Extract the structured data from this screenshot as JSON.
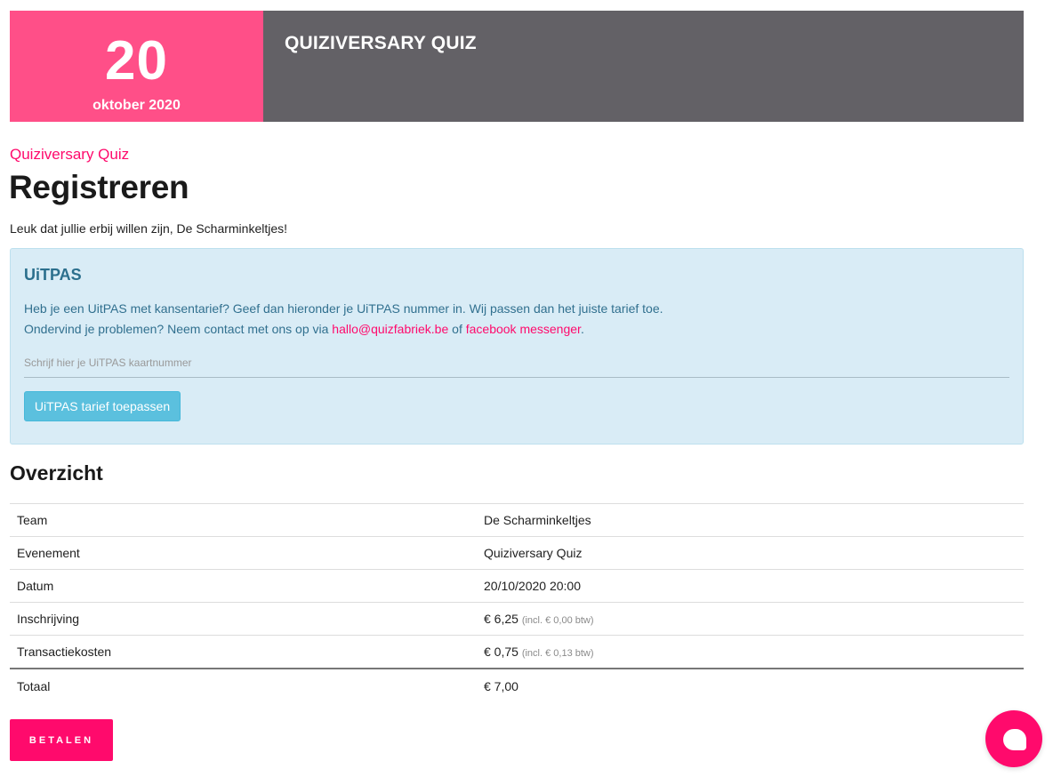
{
  "hero": {
    "day": "20",
    "month": "oktober 2020",
    "title": "QUIZIVERSARY QUIZ"
  },
  "page": {
    "subtitle": "Quiziversary Quiz",
    "title": "Registreren",
    "welcome": "Leuk dat jullie erbij willen zijn, De Scharminkeltjes!"
  },
  "uitpas": {
    "title": "UiTPAS",
    "line1": "Heb je een UitPAS met kansentarief? Geef dan hieronder je UiTPAS nummer in. Wij passen dan het juiste tarief toe.",
    "line2_prefix": "Ondervind je problemen? Neem contact met ons op via ",
    "email_link": "hallo@quizfabriek.be",
    "line2_mid": " of ",
    "messenger_link": "facebook messenger",
    "line2_suffix": ".",
    "input_placeholder": "Schrijf hier je UiTPAS kaartnummer",
    "apply_button": "UiTPAS tarief toepassen"
  },
  "overview": {
    "title": "Overzicht",
    "rows": [
      {
        "label": "Team",
        "value": "De Scharminkeltjes",
        "note": ""
      },
      {
        "label": "Evenement",
        "value": "Quiziversary Quiz",
        "note": ""
      },
      {
        "label": "Datum",
        "value": "20/10/2020 20:00",
        "note": ""
      },
      {
        "label": "Inschrijving",
        "value": "€ 6,25",
        "note": "(incl. € 0,00 btw)"
      },
      {
        "label": "Transactiekosten",
        "value": "€ 0,75",
        "note": "(incl. € 0,13 btw)"
      }
    ],
    "total": {
      "label": "Totaal",
      "value": "€ 7,00"
    }
  },
  "actions": {
    "pay_button": "BETALEN"
  },
  "icons": {
    "chat": "chat-bubble-icon"
  },
  "colors": {
    "accent": "#ff0a6c",
    "hero_date_bg": "#ff4f88",
    "hero_title_bg": "#636166",
    "info_bg": "#d9ecf6",
    "info_button": "#5bc0de"
  }
}
